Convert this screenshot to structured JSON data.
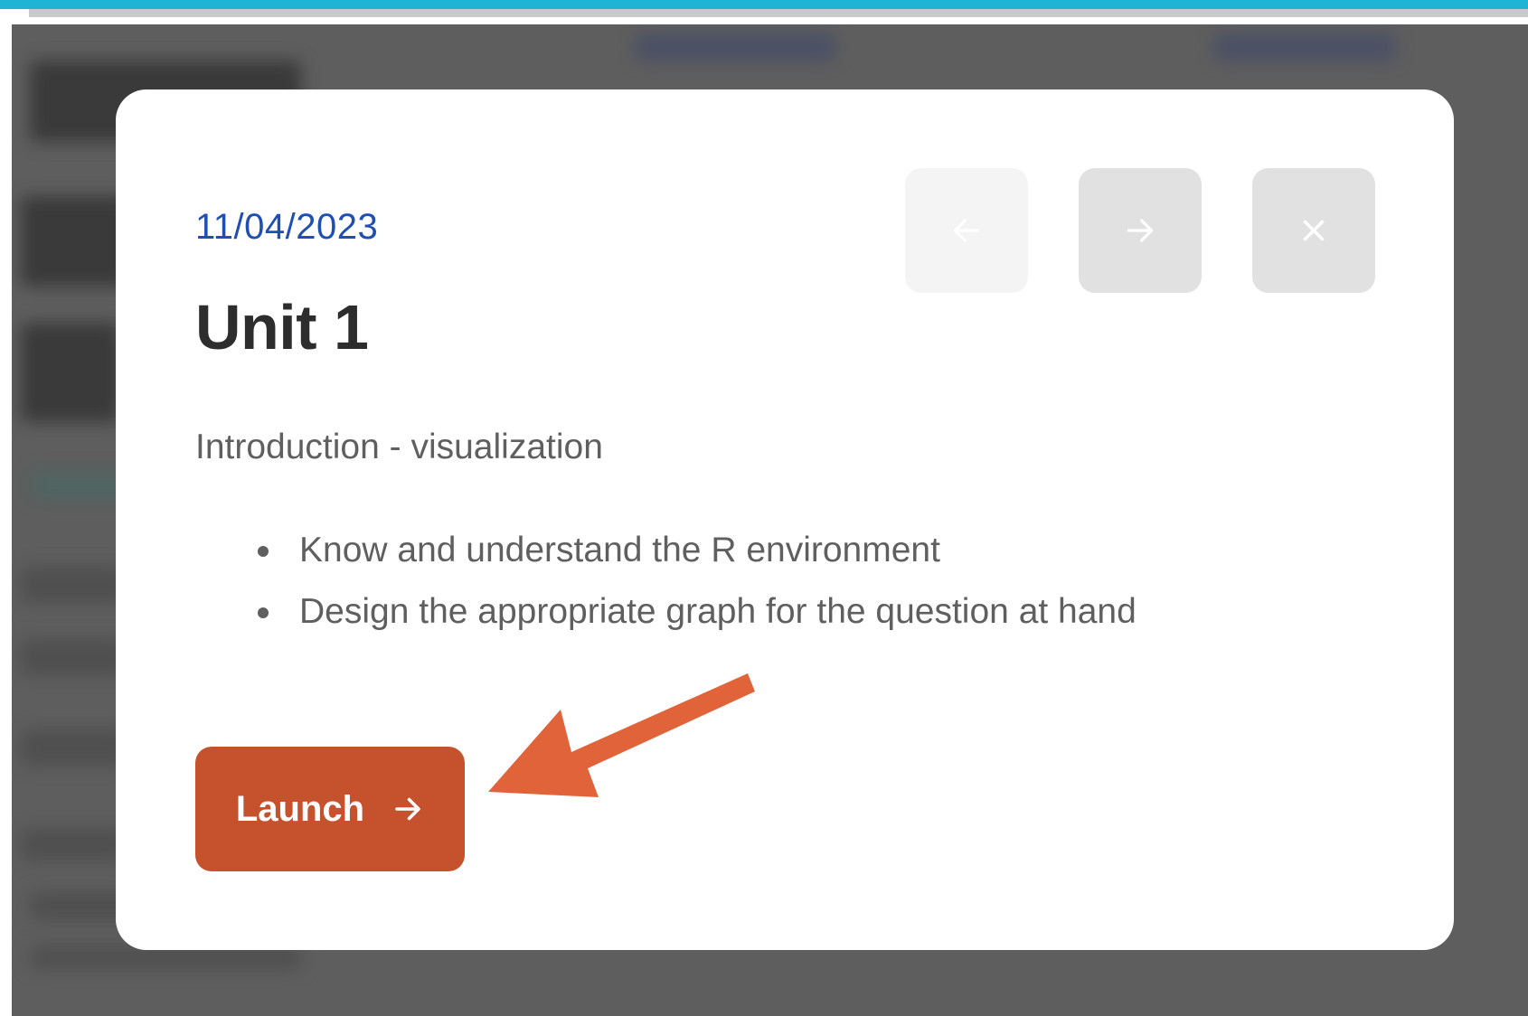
{
  "modal": {
    "date": "11/04/2023",
    "title": "Unit 1",
    "subtitle": "Introduction - visualization",
    "objectives": [
      "Know and understand the R environment",
      "Design the appropriate graph for the question at hand"
    ],
    "launch_label": "Launch",
    "nav": {
      "prev_icon": "arrow-left-icon",
      "next_icon": "arrow-right-icon",
      "close_icon": "close-icon"
    }
  },
  "colors": {
    "accent_blue": "#1f4fb3",
    "launch": "#c6522d",
    "annotation_arrow": "#e0633a",
    "top_strip": "#1fb4d6"
  }
}
